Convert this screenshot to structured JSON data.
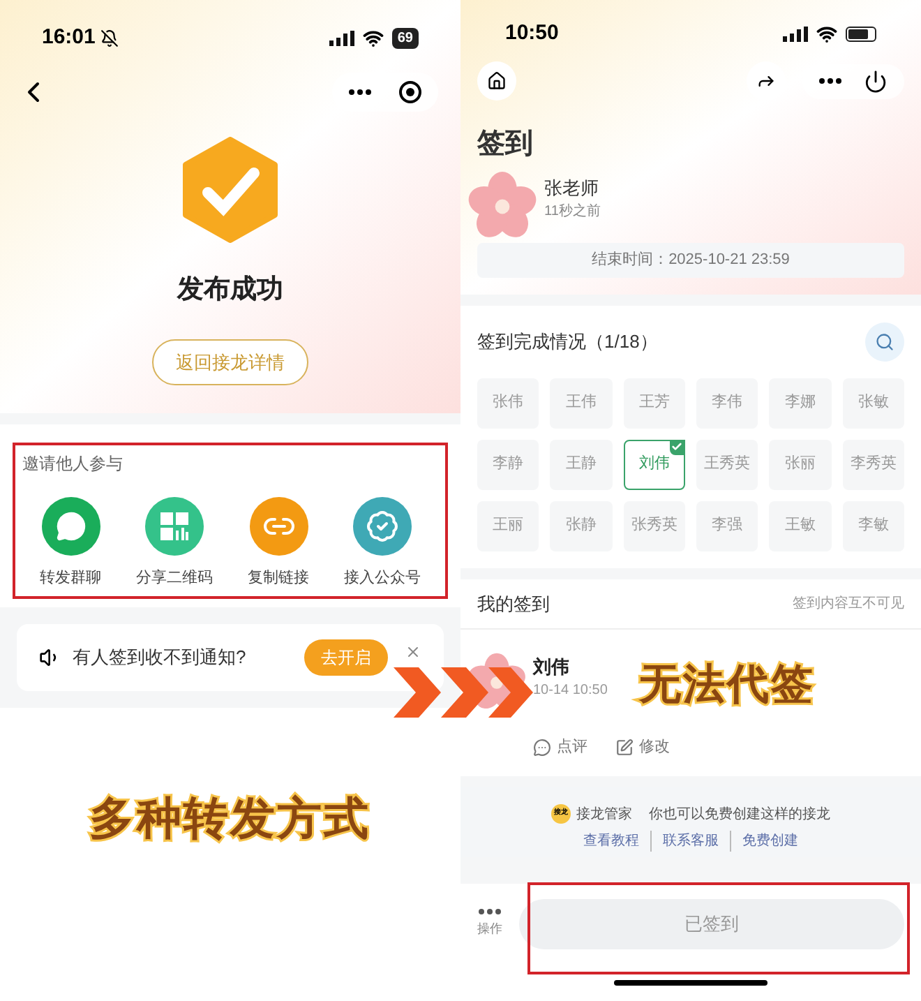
{
  "left_screen": {
    "status_bar": {
      "time": "16:01",
      "battery": "69"
    },
    "success": {
      "title": "发布成功",
      "button": "返回接龙详情"
    },
    "invite": {
      "title": "邀请他人参与",
      "options": [
        {
          "kind": "chat",
          "label": "转发群聊",
          "color": "#1aad5a"
        },
        {
          "kind": "qrcode",
          "label": "分享二维码",
          "color": "#34c28a"
        },
        {
          "kind": "link",
          "label": "复制链接",
          "color": "#f39a12"
        },
        {
          "kind": "badge",
          "label": "接入公众号",
          "color": "#3fa9b5"
        }
      ]
    },
    "notice": {
      "text": "有人签到收不到通知?",
      "button": "去开启"
    }
  },
  "right_screen": {
    "status_bar": {
      "time": "10:50"
    },
    "title": "签到",
    "author": {
      "name": "张老师",
      "time": "11秒之前"
    },
    "end_time": "结束时间：2025-10-21 23:59",
    "completion": {
      "title": "签到完成情况（1/18）",
      "members": [
        {
          "name": "张伟",
          "signed": false
        },
        {
          "name": "王伟",
          "signed": false
        },
        {
          "name": "王芳",
          "signed": false
        },
        {
          "name": "李伟",
          "signed": false
        },
        {
          "name": "李娜",
          "signed": false
        },
        {
          "name": "张敏",
          "signed": false
        },
        {
          "name": "李静",
          "signed": false
        },
        {
          "name": "王静",
          "signed": false
        },
        {
          "name": "刘伟",
          "signed": true
        },
        {
          "name": "王秀英",
          "signed": false
        },
        {
          "name": "张丽",
          "signed": false
        },
        {
          "name": "李秀英",
          "signed": false
        },
        {
          "name": "王丽",
          "signed": false
        },
        {
          "name": "张静",
          "signed": false
        },
        {
          "name": "张秀英",
          "signed": false
        },
        {
          "name": "李强",
          "signed": false
        },
        {
          "name": "王敏",
          "signed": false
        },
        {
          "name": "李敏",
          "signed": false
        }
      ]
    },
    "my_signin": {
      "title": "我的签到",
      "note": "签到内容互不可见",
      "name": "刘伟",
      "time": "10-14 10:50",
      "actions": [
        "点评",
        "修改"
      ]
    },
    "promo": {
      "logo": "接龙",
      "brand": "接龙管家",
      "text": "你也可以免费创建这样的接龙",
      "links": [
        "查看教程",
        "联系客服",
        "免费创建"
      ]
    },
    "bottom_bar": {
      "more": "操作",
      "button": "已签到"
    }
  },
  "annotations": {
    "left_caption": "多种转发方式",
    "right_caption": "无法代签"
  }
}
